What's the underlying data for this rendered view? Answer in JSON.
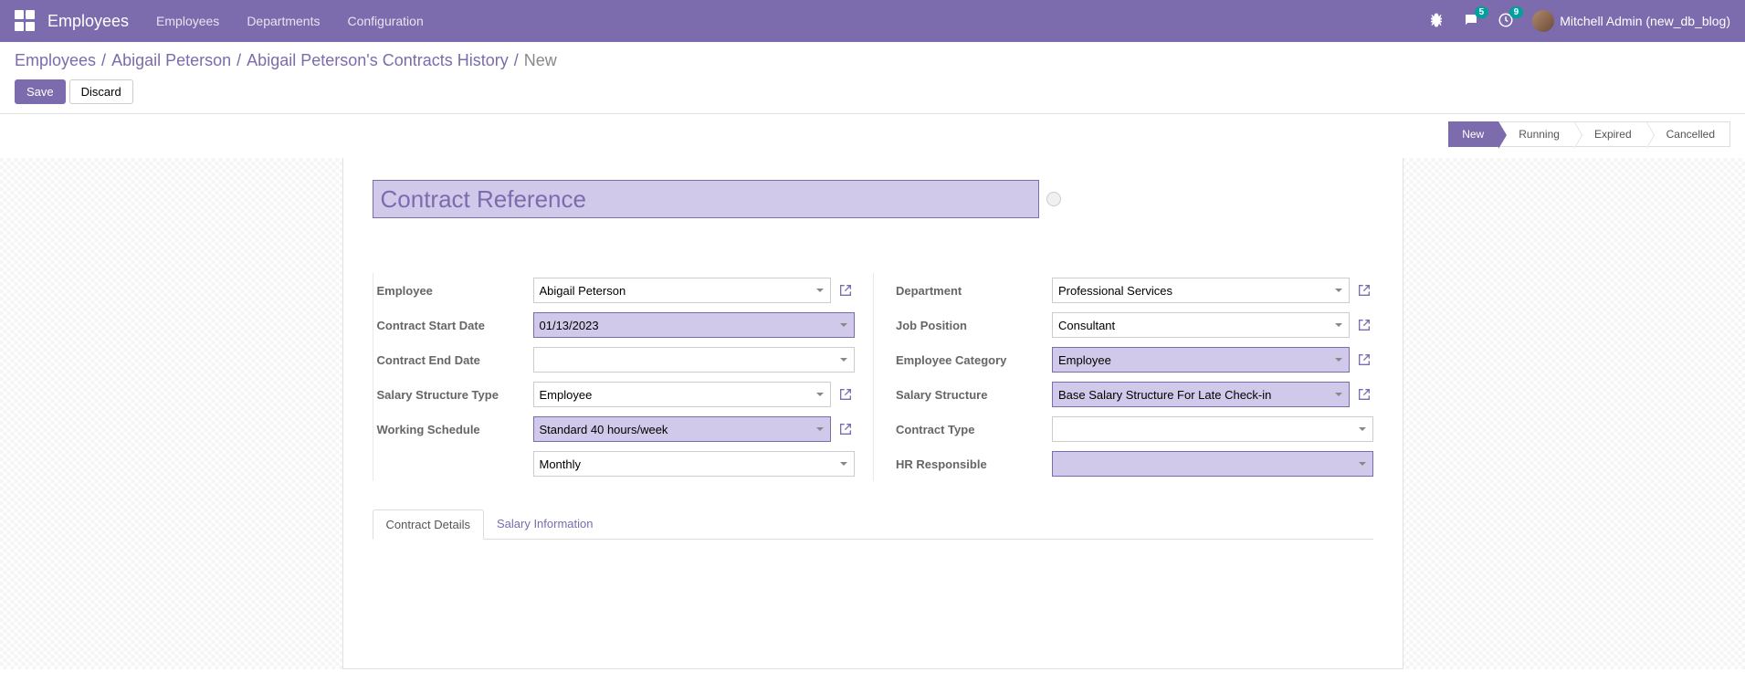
{
  "navbar": {
    "title": "Employees",
    "menu": [
      "Employees",
      "Departments",
      "Configuration"
    ],
    "messages_badge": "5",
    "activities_badge": "9",
    "user_name": "Mitchell Admin (new_db_blog)"
  },
  "breadcrumb": {
    "items": [
      "Employees",
      "Abigail Peterson",
      "Abigail Peterson's Contracts History"
    ],
    "current": "New"
  },
  "actions": {
    "save": "Save",
    "discard": "Discard"
  },
  "statusbar": {
    "steps": [
      "New",
      "Running",
      "Expired",
      "Cancelled"
    ],
    "active": "New"
  },
  "form": {
    "title_placeholder": "Contract Reference",
    "left": {
      "employee": {
        "label": "Employee",
        "value": "Abigail Peterson"
      },
      "start_date": {
        "label": "Contract Start Date",
        "value": "01/13/2023"
      },
      "end_date": {
        "label": "Contract End Date",
        "value": ""
      },
      "salary_struct_type": {
        "label": "Salary Structure Type",
        "value": "Employee"
      },
      "working_schedule": {
        "label": "Working Schedule",
        "value": "Standard 40 hours/week"
      },
      "pay_interval": {
        "value": "Monthly"
      }
    },
    "right": {
      "department": {
        "label": "Department",
        "value": "Professional Services"
      },
      "job_position": {
        "label": "Job Position",
        "value": "Consultant"
      },
      "employee_category": {
        "label": "Employee Category",
        "value": "Employee"
      },
      "salary_structure": {
        "label": "Salary Structure",
        "value": "Base Salary Structure For Late Check-in"
      },
      "contract_type": {
        "label": "Contract Type",
        "value": ""
      },
      "hr_responsible": {
        "label": "HR Responsible",
        "value": ""
      }
    }
  },
  "tabs": {
    "items": [
      "Contract Details",
      "Salary Information"
    ],
    "active": "Contract Details"
  }
}
